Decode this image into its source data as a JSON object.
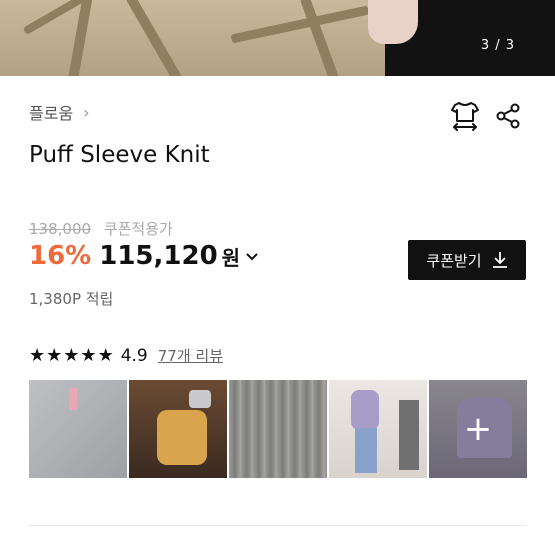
{
  "gallery": {
    "counter": "3 / 3"
  },
  "brand": {
    "name": "플로움",
    "chevron": "›"
  },
  "product": {
    "title": "Puff Sleeve Knit",
    "original_price": "138,000",
    "coupon_price_label": "쿠폰적용가",
    "discount": "16%",
    "price": "115,120",
    "currency": "원",
    "points": "1,380P 적립"
  },
  "coupon_button": {
    "label": "쿠폰받기",
    "icon": "download-icon"
  },
  "rating": {
    "stars": 5,
    "score": "4.9",
    "reviews_label": "77개 리뷰"
  },
  "thumbnails": {
    "count": 5,
    "more_icon": "+"
  },
  "icons": {
    "size": "tshirt-size-icon",
    "share": "share-icon",
    "star": "star-icon"
  }
}
